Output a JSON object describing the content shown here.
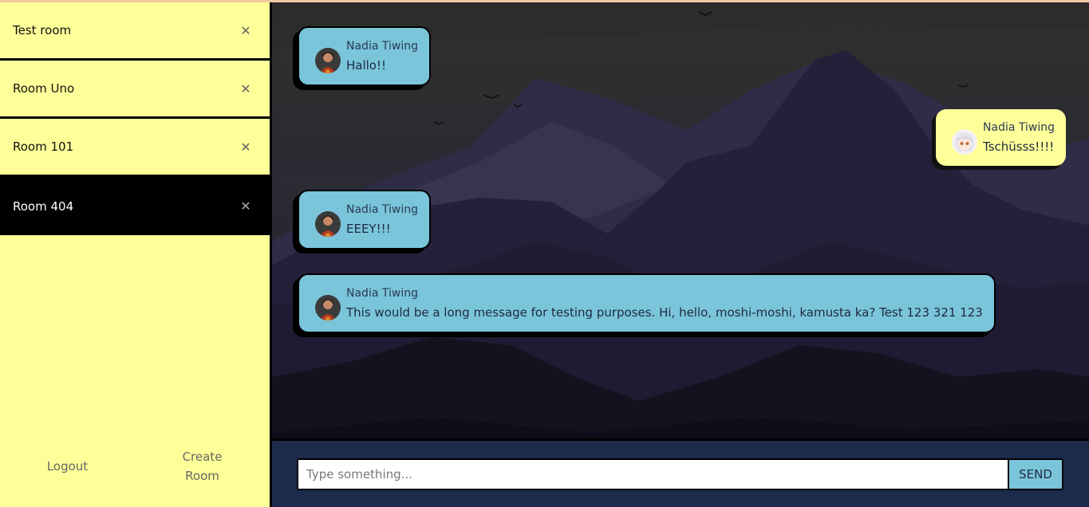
{
  "rooms": [
    {
      "name": "Test room",
      "close": "✕",
      "active": false
    },
    {
      "name": "Room Uno",
      "close": "✕",
      "active": false
    },
    {
      "name": "Room 101",
      "close": "✕",
      "active": false
    },
    {
      "name": "Room 404",
      "close": "✕",
      "active": true
    }
  ],
  "sidebar_footer": {
    "logout_label": "Logout",
    "create_room_line1": "Create",
    "create_room_line2": "Room"
  },
  "messages": [
    {
      "author": "Nadia Tiwing",
      "text": "Hallo!!",
      "side": "left",
      "avatar": "person-avatar"
    },
    {
      "author": "Nadia Tiwing",
      "text": "Tschüsss!!!!",
      "side": "right",
      "avatar": "anime-avatar"
    },
    {
      "author": "Nadia Tiwing",
      "text": "EEEY!!!",
      "side": "left",
      "avatar": "person-avatar"
    },
    {
      "author": "Nadia Tiwing",
      "text": "This would be a long message for testing purposes. Hi, hello, moshi-moshi, kamusta ka? Test 123 321 123",
      "side": "left",
      "avatar": "person-avatar"
    }
  ],
  "composer": {
    "placeholder": "Type something...",
    "value": "",
    "send_label": "SEND"
  },
  "colors": {
    "sidebar_bg": "#ffff99",
    "left_bubble": "#7ac5da",
    "right_bubble": "#ffff99",
    "input_bar": "#1c2a4b",
    "send_button": "#7ac5da"
  }
}
